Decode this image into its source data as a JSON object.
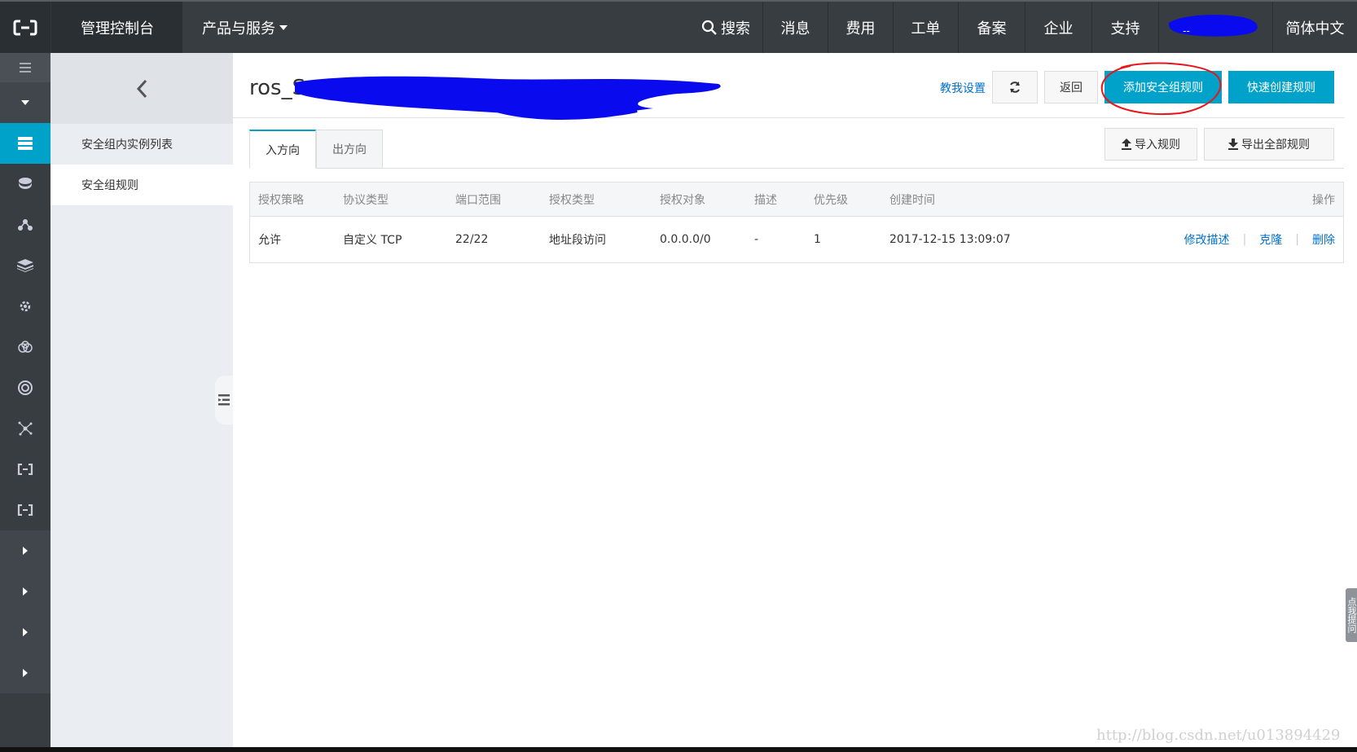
{
  "topbar": {
    "console_label": "管理控制台",
    "products_label": "产品与服务",
    "search_label": "搜索",
    "nav_items": [
      "消息",
      "费用",
      "工单",
      "备案",
      "企业",
      "支持"
    ],
    "user_initial": "--",
    "language_label": "简体中文"
  },
  "sidebar": {
    "items": [
      "安全组内实例列表",
      "安全组规则"
    ]
  },
  "page": {
    "title": "ros_S",
    "tutorial_link": "教我设置",
    "back_button": "返回",
    "add_rule_button": "添加安全组规则",
    "quick_create_button": "快速创建规则",
    "import_button": "导入规则",
    "export_button": "导出全部规则"
  },
  "tabs": [
    "入方向",
    "出方向"
  ],
  "table": {
    "columns": [
      "授权策略",
      "协议类型",
      "端口范围",
      "授权类型",
      "授权对象",
      "描述",
      "优先级",
      "创建时间",
      "操作"
    ],
    "rows": [
      {
        "policy": "允许",
        "protocol": "自定义 TCP",
        "port_range": "22/22",
        "auth_type": "地址段访问",
        "auth_object": "0.0.0.0/0",
        "description": "-",
        "priority": "1",
        "created": "2017-12-15 13:09:07",
        "actions": [
          "修改描述",
          "克隆",
          "删除"
        ]
      }
    ]
  },
  "help_tab": "点我提问",
  "watermark": "http://blog.csdn.net/u013894429",
  "colors": {
    "topbar": "#373d41",
    "accent": "#00a2ca",
    "link": "#0070cc",
    "annotation_circle": "#e8151b",
    "redaction": "#0a0aee"
  }
}
